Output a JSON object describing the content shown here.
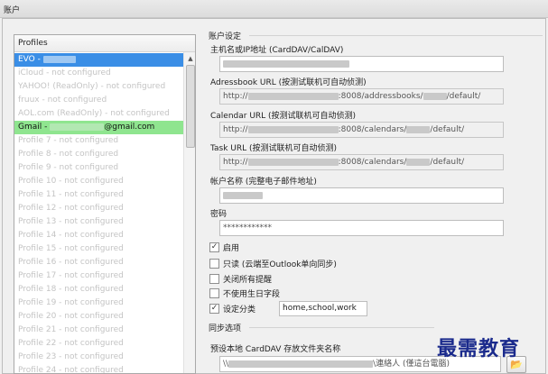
{
  "window": {
    "title": "账户"
  },
  "profiles": {
    "header": "Profiles",
    "items": [
      {
        "label": "EVO - ",
        "state": "selected",
        "redacted": true
      },
      {
        "label": "iCloud - not configured"
      },
      {
        "label": "YAHOO! (ReadOnly) - not configured"
      },
      {
        "label": "fruux - not configured"
      },
      {
        "label": "AOL.com (ReadOnly) - not configured"
      },
      {
        "label": "Gmail - ",
        "suffix": "@gmail.com",
        "state": "green",
        "redacted": true
      },
      {
        "label": "Profile 7 - not configured"
      },
      {
        "label": "Profile 8 - not configured"
      },
      {
        "label": "Profile 9 - not configured"
      },
      {
        "label": "Profile 10 - not configured"
      },
      {
        "label": "Profile 11 - not configured"
      },
      {
        "label": "Profile 12 - not configured"
      },
      {
        "label": "Profile 13 - not configured"
      },
      {
        "label": "Profile 14 - not configured"
      },
      {
        "label": "Profile 15 - not configured"
      },
      {
        "label": "Profile 16 - not configured"
      },
      {
        "label": "Profile 17 - not configured"
      },
      {
        "label": "Profile 18 - not configured"
      },
      {
        "label": "Profile 19 - not configured"
      },
      {
        "label": "Profile 20 - not configured"
      },
      {
        "label": "Profile 21 - not configured"
      },
      {
        "label": "Profile 22 - not configured"
      },
      {
        "label": "Profile 23 - not configured"
      },
      {
        "label": "Profile 24 - not configured"
      }
    ]
  },
  "account": {
    "section_title": "账户设定",
    "host_label": "主机名或IP地址 (CardDAV/CalDAV)",
    "host_value": "",
    "addressbook_label": "Adressbook URL (按测试联机可自动侦测)",
    "addressbook_prefix": "http://",
    "addressbook_mid": ":8008/addressbooks/",
    "addressbook_suffix": "/default/",
    "calendar_label": "Calendar URL (按测试联机可自动侦测)",
    "calendar_prefix": "http://",
    "calendar_mid": ":8008/calendars/",
    "calendar_suffix": "/default/",
    "task_label": "Task URL (按测试联机可自动侦测)",
    "task_prefix": "http://",
    "task_mid": ":8008/calendars/",
    "task_suffix": "/default/",
    "account_name_label": "帐户名称 (完整电子邮件地址)",
    "password_label": "密码",
    "password_value": "************"
  },
  "options": {
    "enable": {
      "label": "启用",
      "checked": true
    },
    "readonly": {
      "label": "只读 (云端至Outlook单向同步)",
      "checked": false
    },
    "disable_reminders": {
      "label": "关闭所有提醒",
      "checked": false
    },
    "no_birthday": {
      "label": "不使用生日字段",
      "checked": false
    },
    "categories": {
      "label": "设定分类",
      "checked": true,
      "value": "home,school,work"
    }
  },
  "sync": {
    "section_title": "同步选项",
    "folder_label": "预设本地 CardDAV 存放文件夹名称",
    "folder_prefix": "\\\\",
    "folder_suffix": "\\連絡人 (僅這台電腦)"
  },
  "watermark": "最需教育",
  "colors": {
    "selected": "#3a8ee6",
    "gmail_row": "#8fe58f",
    "watermark": "#1a2a8c"
  }
}
